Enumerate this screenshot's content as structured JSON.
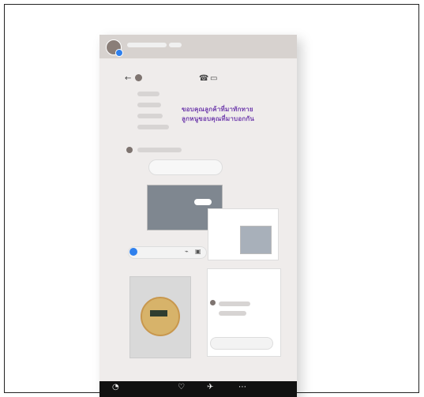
{
  "story": {
    "username": "",
    "time": ""
  },
  "status": {
    "left": "",
    "right": ""
  },
  "overlay": {
    "line1": "ขอบคุณลูกค้าที่มาทักทาย",
    "line2": "ลูกหนูขอบคุณที่มาบอกกัน"
  },
  "composer": {
    "placeholder": ""
  },
  "icons": {
    "back": "back-icon",
    "call": "phone-icon",
    "video": "video-icon",
    "mic": "mic-icon",
    "gallery": "image-icon",
    "bottom_left": "avatar-icon",
    "bottom_mid": "heart-icon",
    "bottom_right": "share-icon",
    "bottom_more": "more-icon"
  },
  "colors": {
    "frame": "#222222",
    "phone_bg": "#efeceb",
    "accent": "#6d3aa8",
    "blue": "#2f80ed",
    "dark_bar": "#111111"
  }
}
